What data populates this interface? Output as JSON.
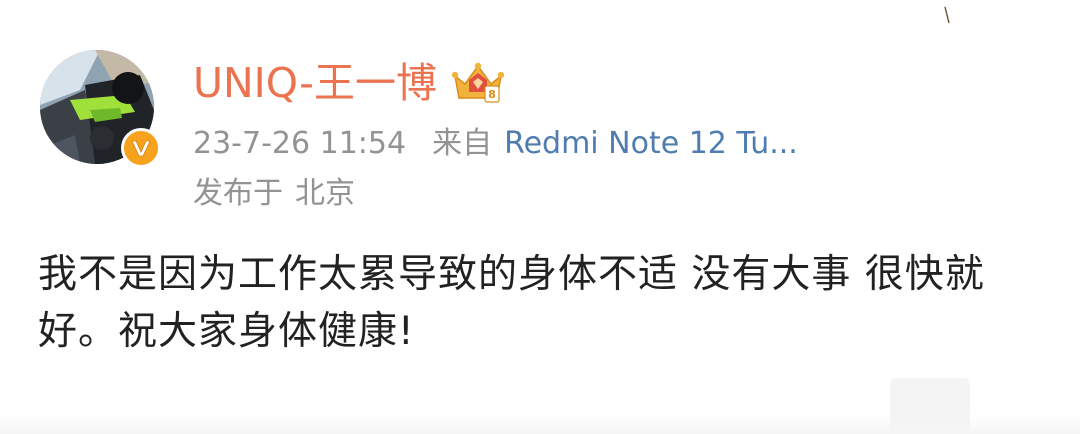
{
  "post": {
    "author": {
      "name": "UNIQ-王一博",
      "avatar_icon": "avatar-photo-motorcycle",
      "verified_icon": "verified-v-icon",
      "member_icon": "crown-member-icon",
      "name_color": "#eb7350",
      "verified_color": "#f6a21d"
    },
    "meta": {
      "time": "23-7-26 11:54",
      "from_label": "来自",
      "device": "Redmi Note 12 Tu...",
      "device_color": "#507daf"
    },
    "location": {
      "label": "发布于",
      "value": "北京"
    },
    "text": "我不是因为工作太累导致的身体不适 没有大事 很快就好。祝大家身体健康!"
  }
}
